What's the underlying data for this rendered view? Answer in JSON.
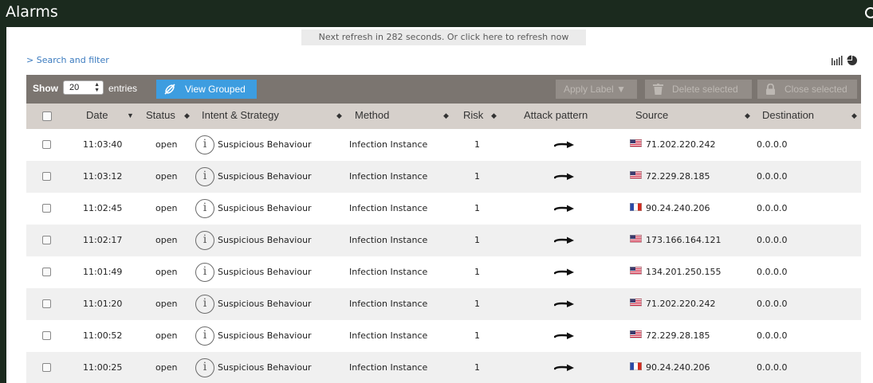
{
  "header": {
    "title": "Alarms"
  },
  "refresh": {
    "text": "Next refresh in 282 seconds. Or click here to refresh now"
  },
  "search": {
    "label": "> Search and filter"
  },
  "toolbar": {
    "show_label": "Show",
    "entries_value": "20",
    "entries_label": "entries",
    "view_grouped": "View Grouped",
    "apply_label": "Apply Label",
    "delete_selected": "Delete selected",
    "close_selected": "Close selected"
  },
  "columns": {
    "date": "Date",
    "status": "Status",
    "intent": "Intent & Strategy",
    "method": "Method",
    "risk": "Risk",
    "attack": "Attack pattern",
    "source": "Source",
    "destination": "Destination"
  },
  "rows": [
    {
      "time": "11:03:40",
      "status": "open",
      "intent": "Suspicious Behaviour",
      "method": "Infection Instance",
      "risk": "1",
      "source": "71.202.220.242",
      "flag": "us",
      "dest": "0.0.0.0"
    },
    {
      "time": "11:03:12",
      "status": "open",
      "intent": "Suspicious Behaviour",
      "method": "Infection Instance",
      "risk": "1",
      "source": "72.229.28.185",
      "flag": "us",
      "dest": "0.0.0.0"
    },
    {
      "time": "11:02:45",
      "status": "open",
      "intent": "Suspicious Behaviour",
      "method": "Infection Instance",
      "risk": "1",
      "source": "90.24.240.206",
      "flag": "fr",
      "dest": "0.0.0.0"
    },
    {
      "time": "11:02:17",
      "status": "open",
      "intent": "Suspicious Behaviour",
      "method": "Infection Instance",
      "risk": "1",
      "source": "173.166.164.121",
      "flag": "us",
      "dest": "0.0.0.0"
    },
    {
      "time": "11:01:49",
      "status": "open",
      "intent": "Suspicious Behaviour",
      "method": "Infection Instance",
      "risk": "1",
      "source": "134.201.250.155",
      "flag": "us",
      "dest": "0.0.0.0"
    },
    {
      "time": "11:01:20",
      "status": "open",
      "intent": "Suspicious Behaviour",
      "method": "Infection Instance",
      "risk": "1",
      "source": "71.202.220.242",
      "flag": "us",
      "dest": "0.0.0.0"
    },
    {
      "time": "11:00:52",
      "status": "open",
      "intent": "Suspicious Behaviour",
      "method": "Infection Instance",
      "risk": "1",
      "source": "72.229.28.185",
      "flag": "us",
      "dest": "0.0.0.0"
    },
    {
      "time": "11:00:25",
      "status": "open",
      "intent": "Suspicious Behaviour",
      "method": "Infection Instance",
      "risk": "1",
      "source": "90.24.240.206",
      "flag": "fr",
      "dest": "0.0.0.0"
    }
  ]
}
